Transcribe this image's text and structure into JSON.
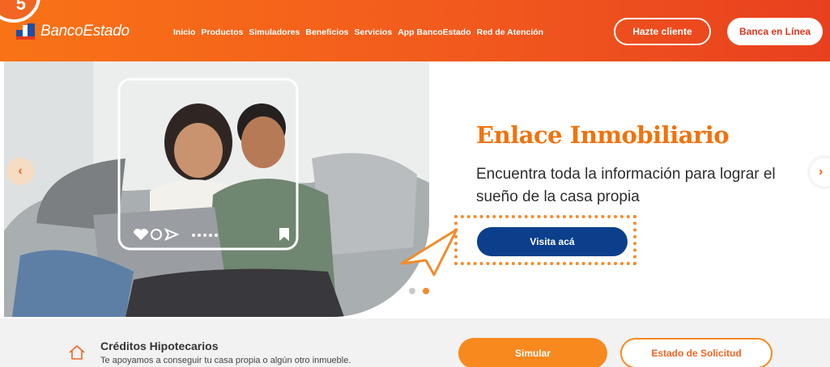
{
  "brand": {
    "name": "BancoEstado",
    "accent": "#f26522",
    "navy": "#0b3f8c"
  },
  "nav": {
    "items": [
      "Inicio",
      "Productos",
      "Simuladores",
      "Beneficios",
      "Servicios",
      "App BancoEstado",
      "Red de Atención"
    ]
  },
  "header": {
    "cta_primary": "Hazte cliente",
    "cta_secondary": "Banca en Línea"
  },
  "hero": {
    "title": "Enlace Inmobiliario",
    "description": "Encuentra toda la información para lograr el sueño de la casa propia",
    "button": "Visita acá",
    "slide_total": 2,
    "slide_active": 2
  },
  "products": {
    "title": "Créditos Hipotecarios",
    "subtitle": "Te apoyamos a conseguir tu casa propia o algún otro inmueble.",
    "btn_simulate": "Simular",
    "btn_status": "Estado de Solicitud"
  }
}
